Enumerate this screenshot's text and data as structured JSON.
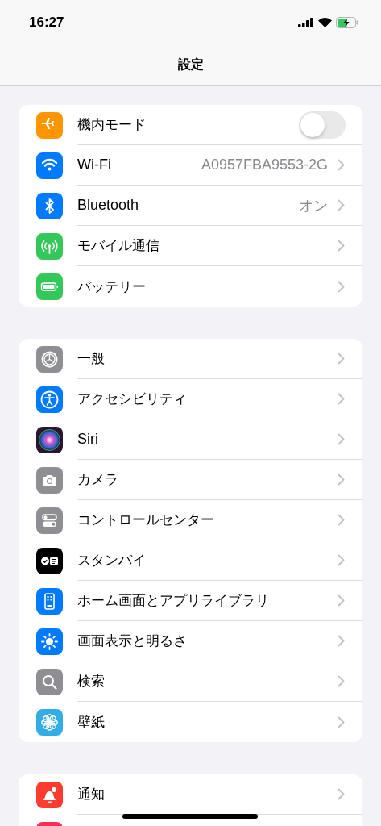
{
  "status_bar": {
    "time": "16:27"
  },
  "nav": {
    "title": "設定"
  },
  "groups": [
    {
      "items": [
        {
          "kind": "toggle",
          "label": "機内モード",
          "color": "#ff9500",
          "on": false
        },
        {
          "kind": "link",
          "label": "Wi-Fi",
          "value": "A0957FBA9553-2G",
          "color": "#007aff"
        },
        {
          "kind": "link",
          "label": "Bluetooth",
          "value": "オン",
          "color": "#007aff"
        },
        {
          "kind": "link",
          "label": "モバイル通信",
          "color": "#34c759"
        },
        {
          "kind": "link",
          "label": "バッテリー",
          "color": "#34c759"
        }
      ]
    },
    {
      "items": [
        {
          "kind": "link",
          "label": "一般",
          "color": "#8e8e93"
        },
        {
          "kind": "link",
          "label": "アクセシビリティ",
          "color": "#007aff"
        },
        {
          "kind": "link",
          "label": "Siri",
          "color": "#2b1630"
        },
        {
          "kind": "link",
          "label": "カメラ",
          "color": "#8e8e93"
        },
        {
          "kind": "link",
          "label": "コントロールセンター",
          "color": "#8e8e93"
        },
        {
          "kind": "link",
          "label": "スタンバイ",
          "color": "#000000"
        },
        {
          "kind": "link",
          "label": "ホーム画面とアプリライブラリ",
          "color": "#007aff"
        },
        {
          "kind": "link",
          "label": "画面表示と明るさ",
          "color": "#007aff"
        },
        {
          "kind": "link",
          "label": "検索",
          "color": "#8e8e93"
        },
        {
          "kind": "link",
          "label": "壁紙",
          "color": "#32ade6"
        }
      ]
    },
    {
      "items": [
        {
          "kind": "link",
          "label": "通知",
          "color": "#ff3b30"
        },
        {
          "kind": "link",
          "color": "#ff2d55"
        }
      ]
    }
  ]
}
